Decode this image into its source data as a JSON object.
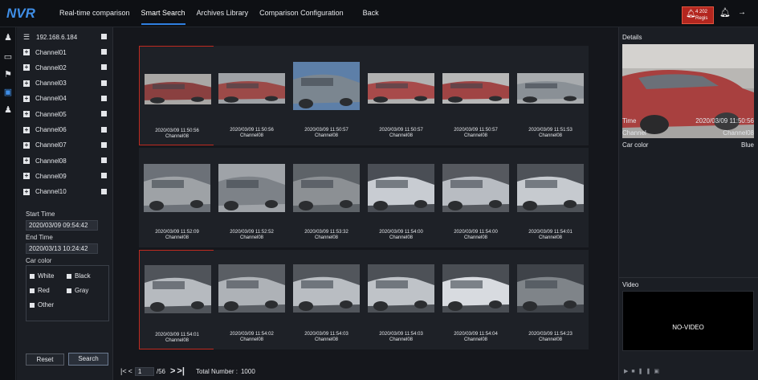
{
  "app": {
    "logo": "NVR"
  },
  "nav": [
    {
      "label": "Real-time comparison",
      "active": false
    },
    {
      "label": "Smart Search",
      "active": true
    },
    {
      "label": "Archives Library",
      "active": false
    },
    {
      "label": "Comparison Configuration",
      "active": false
    },
    {
      "label": "Back",
      "active": false
    }
  ],
  "alarm": {
    "line1": "4 202",
    "line2": "Regis"
  },
  "device": {
    "ip": "192.168.6.184"
  },
  "channels": [
    "Channel01",
    "Channel02",
    "Channel03",
    "Channel04",
    "Channel05",
    "Channel06",
    "Channel07",
    "Channel08",
    "Channel09",
    "Channel10"
  ],
  "search": {
    "start_label": "Start Time",
    "start_value": "2020/03/09 09:54:42",
    "end_label": "End Time",
    "end_value": "2020/03/13 10:24:42",
    "color_label": "Car color",
    "colors": [
      "White",
      "Black",
      "Red",
      "Gray",
      "Other"
    ],
    "reset": "Reset",
    "search": "Search"
  },
  "results": [
    {
      "time": "2020/03/09 11:50:56",
      "channel": "Channel08",
      "selected": true
    },
    {
      "time": "2020/03/09 11:50:56",
      "channel": "Channel08",
      "selected": false
    },
    {
      "time": "2020/03/09 11:50:57",
      "channel": "Channel08",
      "selected": false
    },
    {
      "time": "2020/03/09 11:50:57",
      "channel": "Channel08",
      "selected": false
    },
    {
      "time": "2020/03/09 11:50:57",
      "channel": "Channel08",
      "selected": false
    },
    {
      "time": "2020/03/09 11:51:53",
      "channel": "Channel08",
      "selected": false
    },
    {
      "time": "2020/03/09 11:52:09",
      "channel": "Channel08",
      "selected": false
    },
    {
      "time": "2020/03/09 11:52:52",
      "channel": "Channel08",
      "selected": false
    },
    {
      "time": "2020/03/09 11:53:32",
      "channel": "Channel08",
      "selected": false
    },
    {
      "time": "2020/03/09 11:54:00",
      "channel": "Channel08",
      "selected": false
    },
    {
      "time": "2020/03/09 11:54:00",
      "channel": "Channel08",
      "selected": false
    },
    {
      "time": "2020/03/09 11:54:01",
      "channel": "Channel08",
      "selected": false
    },
    {
      "time": "2020/03/09 11:54:01",
      "channel": "Channel08",
      "selected": true
    },
    {
      "time": "2020/03/09 11:54:02",
      "channel": "Channel08",
      "selected": false
    },
    {
      "time": "2020/03/09 11:54:03",
      "channel": "Channel08",
      "selected": false
    },
    {
      "time": "2020/03/09 11:54:03",
      "channel": "Channel08",
      "selected": false
    },
    {
      "time": "2020/03/09 11:54:04",
      "channel": "Channel08",
      "selected": false
    },
    {
      "time": "2020/03/09 11:54:23",
      "channel": "Channel08",
      "selected": false
    }
  ],
  "pager": {
    "first": "|<",
    "prev": "<",
    "page": "1",
    "total_pages": "/56",
    "next": ">",
    "last": ">|",
    "total_label": "Total Number :",
    "total_value": "1000"
  },
  "details": {
    "title": "Details",
    "time_label": "Time",
    "time_value": "2020/03/09 11:50:56",
    "channel_label": "Channel",
    "channel_value": "Channel08",
    "color_label": "Car color",
    "color_value": "Blue"
  },
  "video": {
    "title": "Video",
    "status": "NO-VIDEO"
  },
  "colors": {
    "accent": "#2f7fe0",
    "alarm": "#b3261f",
    "selection": "#c02a20"
  }
}
